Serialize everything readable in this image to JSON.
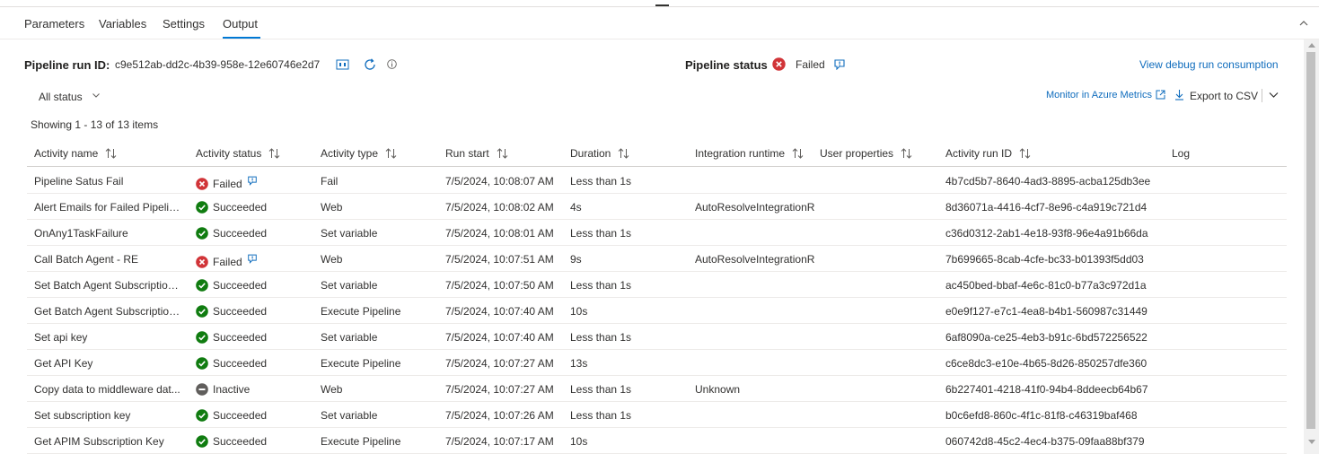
{
  "tabs": [
    {
      "label": "Parameters"
    },
    {
      "label": "Variables"
    },
    {
      "label": "Settings"
    },
    {
      "label": "Output"
    }
  ],
  "header": {
    "run_id_label": "Pipeline run ID:",
    "run_id_value": "c9e512ab-dd2c-4b39-958e-12e60746e2d7",
    "status_label": "Pipeline status",
    "status_value": "Failed",
    "debug_link": "View debug run consumption"
  },
  "toolbar": {
    "filter_label": "All status",
    "monitor_link": "Monitor in Azure Metrics",
    "export_label": "Export to CSV"
  },
  "showing": "Showing 1 - 13 of 13 items",
  "columns": [
    {
      "label": "Activity name"
    },
    {
      "label": "Activity status"
    },
    {
      "label": "Activity type"
    },
    {
      "label": "Run start"
    },
    {
      "label": "Duration"
    },
    {
      "label": "Integration runtime"
    },
    {
      "label": "User properties"
    },
    {
      "label": "Activity run ID"
    },
    {
      "label": "Log"
    }
  ],
  "rows": [
    {
      "name": "Pipeline Satus Fail",
      "status": "Failed",
      "type": "Fail",
      "start": "7/5/2024, 10:08:07 AM",
      "duration": "Less than 1s",
      "ir": "",
      "run_id": "4b7cd5b7-8640-4ad3-8895-acba125db3ee"
    },
    {
      "name": "Alert Emails for Failed Pipelines",
      "status": "Succeeded",
      "type": "Web",
      "start": "7/5/2024, 10:08:02 AM",
      "duration": "4s",
      "ir": "AutoResolveIntegrationR",
      "run_id": "8d36071a-4416-4cf7-8e96-c4a919c721d4"
    },
    {
      "name": "OnAny1TaskFailure",
      "status": "Succeeded",
      "type": "Set variable",
      "start": "7/5/2024, 10:08:01 AM",
      "duration": "Less than 1s",
      "ir": "",
      "run_id": "c36d0312-2ab1-4e18-93f8-96e4a91b66da"
    },
    {
      "name": "Call Batch Agent - RE",
      "status": "Failed",
      "type": "Web",
      "start": "7/5/2024, 10:07:51 AM",
      "duration": "9s",
      "ir": "AutoResolveIntegrationR",
      "run_id": "7b699665-8cab-4cfe-bc33-b01393f5dd03"
    },
    {
      "name": "Set Batch Agent Subscription ...",
      "status": "Succeeded",
      "type": "Set variable",
      "start": "7/5/2024, 10:07:50 AM",
      "duration": "Less than 1s",
      "ir": "",
      "run_id": "ac450bed-bbaf-4e6c-81c0-b77a3c972d1a"
    },
    {
      "name": "Get Batch Agent Subscription...",
      "status": "Succeeded",
      "type": "Execute Pipeline",
      "start": "7/5/2024, 10:07:40 AM",
      "duration": "10s",
      "ir": "",
      "run_id": "e0e9f127-e7c1-4ea8-b4b1-560987c31449"
    },
    {
      "name": "Set api key",
      "status": "Succeeded",
      "type": "Set variable",
      "start": "7/5/2024, 10:07:40 AM",
      "duration": "Less than 1s",
      "ir": "",
      "run_id": "6af8090a-ce25-4eb3-b91c-6bd572256522"
    },
    {
      "name": "Get API Key",
      "status": "Succeeded",
      "type": "Execute Pipeline",
      "start": "7/5/2024, 10:07:27 AM",
      "duration": "13s",
      "ir": "",
      "run_id": "c6ce8dc3-e10e-4b65-8d26-850257dfe360"
    },
    {
      "name": "Copy data to middleware dat...",
      "status": "Inactive",
      "type": "Web",
      "start": "7/5/2024, 10:07:27 AM",
      "duration": "Less than 1s",
      "ir": "Unknown",
      "run_id": "6b227401-4218-41f0-94b4-8ddeecb64b67"
    },
    {
      "name": "Set subscription key",
      "status": "Succeeded",
      "type": "Set variable",
      "start": "7/5/2024, 10:07:26 AM",
      "duration": "Less than 1s",
      "ir": "",
      "run_id": "b0c6efd8-860c-4f1c-81f8-c46319baf468"
    },
    {
      "name": "Get APIM Subscription Key",
      "status": "Succeeded",
      "type": "Execute Pipeline",
      "start": "7/5/2024, 10:07:17 AM",
      "duration": "10s",
      "ir": "",
      "run_id": "060742d8-45c2-4ec4-b375-09faa88bf379"
    }
  ],
  "icons": {
    "failed": "failed-icon",
    "succeeded": "succeeded-icon",
    "inactive": "inactive-icon",
    "error_details": "error-details-icon"
  },
  "colors": {
    "accent": "#0078d4",
    "link": "#0f6cbd",
    "failed": "#d13438",
    "succeeded": "#107c10",
    "inactive": "#605e5c"
  }
}
